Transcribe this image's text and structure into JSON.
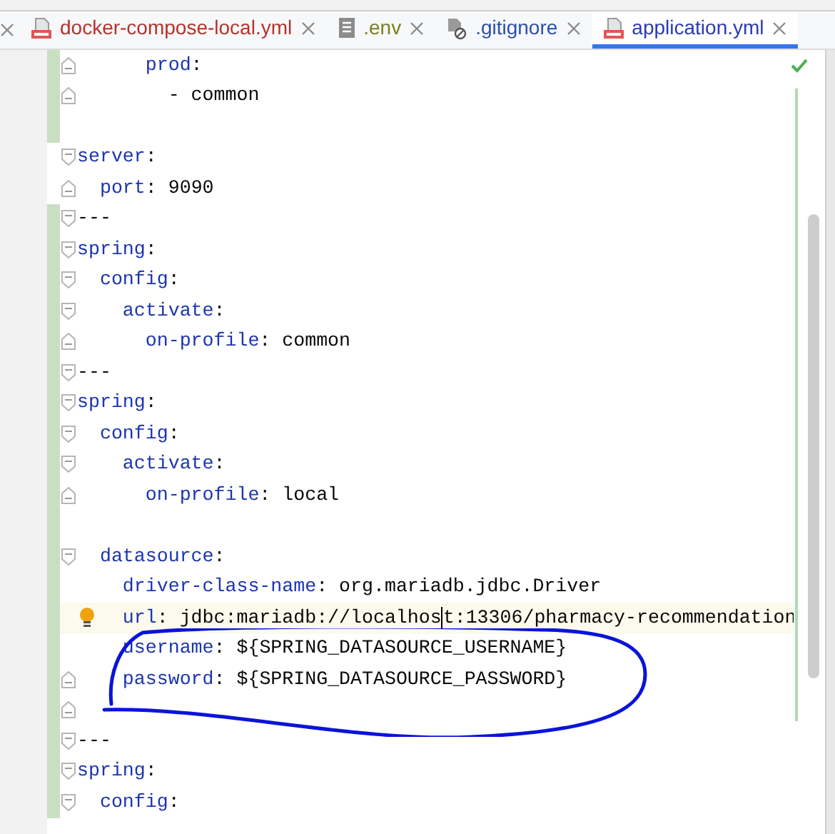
{
  "tabs": [
    {
      "label": "docker-compose-local.yml",
      "kind": "yml",
      "color": "#b8322a",
      "selected": false
    },
    {
      "label": ".env",
      "kind": "text",
      "color": "#7a7f1e",
      "selected": false
    },
    {
      "label": ".gitignore",
      "kind": "ignore",
      "color": "#2a4fb0",
      "selected": false
    },
    {
      "label": "application.yml",
      "kind": "yml",
      "color": "#2a3bb5",
      "selected": true
    }
  ],
  "editor": {
    "lines": [
      {
        "key": "      prod",
        "colon": ":",
        "fold_start": false,
        "fold_end": true,
        "changed": true
      },
      {
        "text": "        - common",
        "fold_start": false,
        "fold_end": true,
        "changed": true
      },
      {
        "fold_start": false,
        "fold_end": false,
        "changed": true
      },
      {
        "key": "server",
        "colon": ":",
        "fold_start": true,
        "fold_end": false,
        "changed": false
      },
      {
        "key": "  port",
        "colon": ":",
        "value": " 9090",
        "fold_start": false,
        "fold_end": true,
        "changed": false
      },
      {
        "text": "---",
        "fold_start": true,
        "fold_end": false,
        "changed": true
      },
      {
        "key": "spring",
        "colon": ":",
        "fold_start": true,
        "fold_end": false,
        "changed": true
      },
      {
        "key": "  config",
        "colon": ":",
        "fold_start": true,
        "fold_end": false,
        "changed": true
      },
      {
        "key": "    activate",
        "colon": ":",
        "fold_start": true,
        "fold_end": false,
        "changed": true
      },
      {
        "key": "      on-profile",
        "colon": ":",
        "value": " common",
        "fold_start": false,
        "fold_end": true,
        "changed": true
      },
      {
        "text": "---",
        "fold_start": true,
        "fold_end": false,
        "changed": true
      },
      {
        "key": "spring",
        "colon": ":",
        "fold_start": true,
        "fold_end": false,
        "changed": true
      },
      {
        "key": "  config",
        "colon": ":",
        "fold_start": true,
        "fold_end": false,
        "changed": true
      },
      {
        "key": "    activate",
        "colon": ":",
        "fold_start": true,
        "fold_end": false,
        "changed": true
      },
      {
        "key": "      on-profile",
        "colon": ":",
        "value": " local",
        "fold_start": false,
        "fold_end": true,
        "changed": true
      },
      {
        "fold_start": false,
        "fold_end": false,
        "changed": true
      },
      {
        "key": "  datasource",
        "colon": ":",
        "fold_start": true,
        "fold_end": false,
        "changed": true
      },
      {
        "key": "    driver-class-name",
        "colon": ":",
        "value": " org.mariadb.jdbc.Driver",
        "fold_start": false,
        "fold_end": false,
        "changed": true
      },
      {
        "key": "    url",
        "colon": ":",
        "value": " jdbc:mariadb://localhos",
        "value_tail": "t:13306/pharmacy-recommendation",
        "current": true,
        "hint": true,
        "fold_start": false,
        "fold_end": false,
        "changed": true
      },
      {
        "key": "    username",
        "colon": ":",
        "value": " ${SPRING_DATASOURCE_USERNAME}",
        "fold_start": false,
        "fold_end": false,
        "changed": true
      },
      {
        "key": "    password",
        "colon": ":",
        "value": " ${SPRING_DATASOURCE_PASSWORD}",
        "fold_start": false,
        "fold_end": true,
        "changed": true
      },
      {
        "fold_start": false,
        "fold_end": true,
        "changed": true
      },
      {
        "text": "---",
        "fold_start": true,
        "fold_end": false,
        "changed": true
      },
      {
        "key": "spring",
        "colon": ":",
        "fold_start": true,
        "fold_end": false,
        "changed": true
      },
      {
        "key": "  config",
        "colon": ":",
        "fold_start": true,
        "fold_end": false,
        "changed": true
      }
    ]
  }
}
